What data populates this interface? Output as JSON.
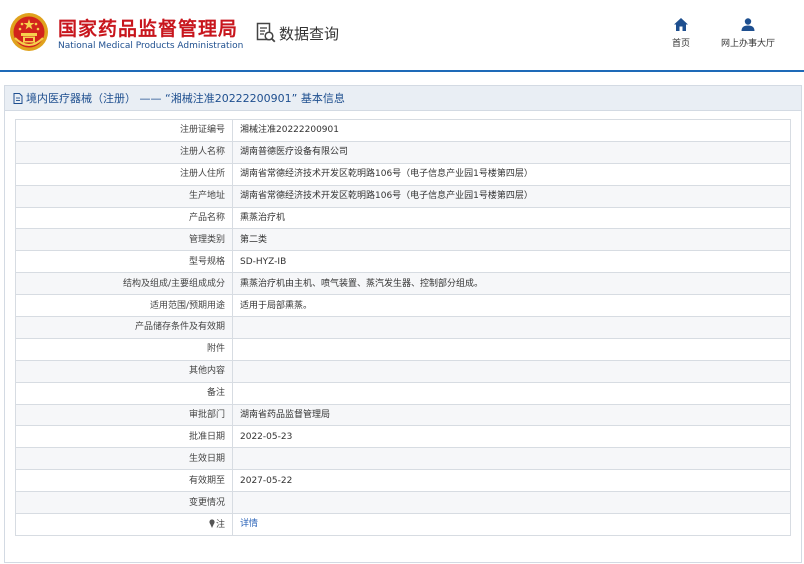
{
  "header": {
    "org_name_cn": "国家药品监督管理局",
    "org_name_en": "National Medical Products Administration",
    "query_label": "数据查询",
    "nav": [
      {
        "label": "首页",
        "icon": "home-icon"
      },
      {
        "label": "网上办事大厅",
        "icon": "user-icon"
      }
    ],
    "emblem": "national-emblem",
    "colors": {
      "brand_red": "#c8161d",
      "brand_blue": "#1e6ab8"
    }
  },
  "section": {
    "title": "境内医疗器械（注册） —— “湘械注准20222200901” 基本信息",
    "rows": [
      {
        "label": "注册证编号",
        "value": "湘械注准20222200901"
      },
      {
        "label": "注册人名称",
        "value": "湖南普德医疗设备有限公司"
      },
      {
        "label": "注册人住所",
        "value": "湖南省常德经济技术开发区乾明路106号（电子信息产业园1号楼第四层）"
      },
      {
        "label": "生产地址",
        "value": "湖南省常德经济技术开发区乾明路106号（电子信息产业园1号楼第四层）"
      },
      {
        "label": "产品名称",
        "value": "熏蒸治疗机"
      },
      {
        "label": "管理类别",
        "value": "第二类"
      },
      {
        "label": "型号规格",
        "value": "SD-HYZ-IB"
      },
      {
        "label": "结构及组成/主要组成成分",
        "value": "熏蒸治疗机由主机、喷气装置、蒸汽发生器、控制部分组成。"
      },
      {
        "label": "适用范围/预期用途",
        "value": "适用于局部熏蒸。"
      },
      {
        "label": "产品储存条件及有效期",
        "value": ""
      },
      {
        "label": "附件",
        "value": ""
      },
      {
        "label": "其他内容",
        "value": ""
      },
      {
        "label": "备注",
        "value": ""
      },
      {
        "label": "审批部门",
        "value": "湖南省药品监督管理局"
      },
      {
        "label": "批准日期",
        "value": "2022-05-23"
      },
      {
        "label": "生效日期",
        "value": ""
      },
      {
        "label": "有效期至",
        "value": "2027-05-22"
      },
      {
        "label": "变更情况",
        "value": ""
      }
    ],
    "note_row": {
      "label": "注",
      "value": "详情"
    }
  }
}
